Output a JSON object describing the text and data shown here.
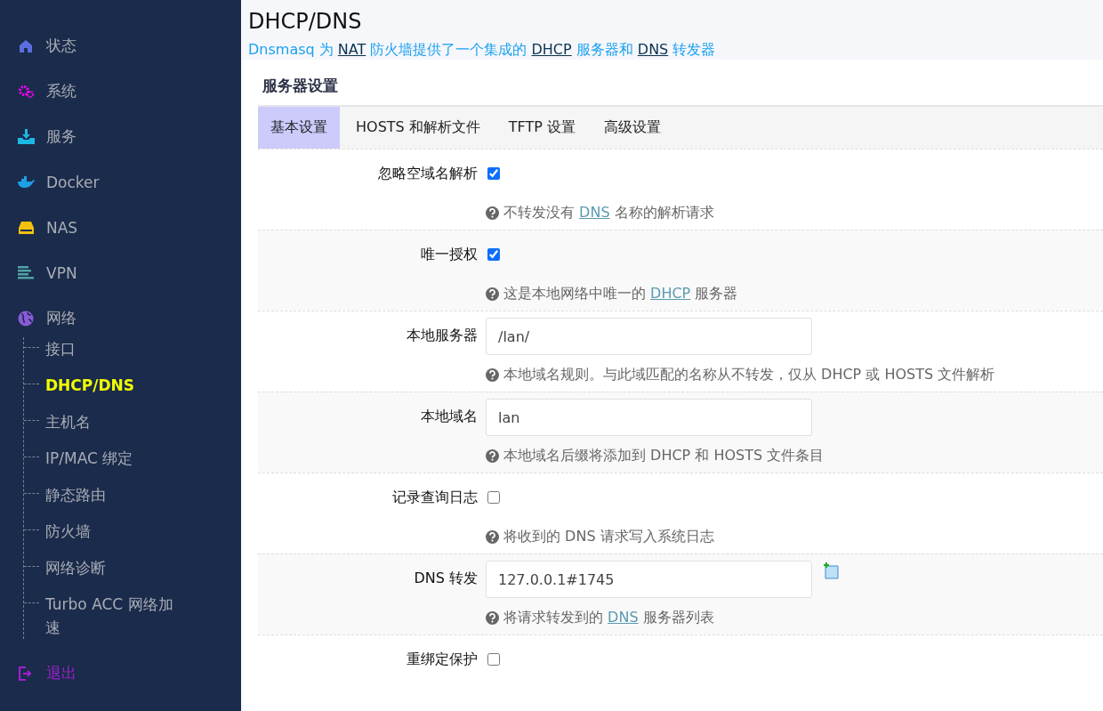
{
  "sidebar": {
    "items": [
      {
        "label": "状态",
        "kind": "home",
        "selected": false
      },
      {
        "label": "系统",
        "kind": "gears",
        "selected": false
      },
      {
        "label": "服务",
        "kind": "download",
        "selected": false
      },
      {
        "label": "Docker",
        "kind": "whale",
        "selected": false
      },
      {
        "label": "NAS",
        "kind": "drive",
        "selected": false
      },
      {
        "label": "VPN",
        "kind": "lines",
        "selected": false
      },
      {
        "label": "网络",
        "kind": "globe",
        "selected": false,
        "children": [
          {
            "label": "接口",
            "selected": false
          },
          {
            "label": "DHCP/DNS",
            "selected": true
          },
          {
            "label": "主机名",
            "selected": false
          },
          {
            "label": "IP/MAC 绑定",
            "selected": false
          },
          {
            "label": "静态路由",
            "selected": false
          },
          {
            "label": "防火墙",
            "selected": false
          },
          {
            "label": "网络诊断",
            "selected": false
          },
          {
            "label": "Turbo ACC 网络加速",
            "selected": false
          }
        ]
      },
      {
        "label": "退出",
        "kind": "logout",
        "selected": false
      }
    ]
  },
  "page": {
    "title": "DHCP/DNS",
    "description": [
      {
        "kind": "text",
        "text": "Dnsmasq 为 "
      },
      {
        "kind": "link",
        "text": "NAT"
      },
      {
        "kind": "text",
        "text": " 防火墙提供了一个集成的 "
      },
      {
        "kind": "link",
        "text": "DHCP"
      },
      {
        "kind": "text",
        "text": " 服务器和 "
      },
      {
        "kind": "link",
        "text": "DNS"
      },
      {
        "kind": "text",
        "text": " 转发器"
      }
    ]
  },
  "section": {
    "title": "服务器设置",
    "tabs": [
      {
        "label": "基本设置",
        "selected": true
      },
      {
        "label": "HOSTS 和解析文件",
        "selected": false
      },
      {
        "label": "TFTP 设置",
        "selected": false
      },
      {
        "label": "高级设置",
        "selected": false
      }
    ],
    "rows": [
      {
        "label": "忽略空域名解析",
        "kind": "checkbox",
        "checked": true,
        "hint": [
          {
            "kind": "text",
            "text": "不转发没有 "
          },
          {
            "kind": "link",
            "text": "DNS"
          },
          {
            "kind": "text",
            "text": " 名称的解析请求"
          }
        ]
      },
      {
        "label": "唯一授权",
        "kind": "checkbox",
        "checked": true,
        "hint": [
          {
            "kind": "text",
            "text": "这是本地网络中唯一的 "
          },
          {
            "kind": "link",
            "text": "DHCP"
          },
          {
            "kind": "text",
            "text": " 服务器"
          }
        ]
      },
      {
        "label": "本地服务器",
        "kind": "input",
        "value": "/lan/",
        "hint": [
          {
            "kind": "text",
            "text": "本地域名规则。与此域匹配的名称从不转发，仅从 DHCP 或 HOSTS 文件解析"
          }
        ]
      },
      {
        "label": "本地域名",
        "kind": "input",
        "value": "lan",
        "hint": [
          {
            "kind": "text",
            "text": "本地域名后缀将添加到 DHCP 和 HOSTS 文件条目"
          }
        ]
      },
      {
        "label": "记录查询日志",
        "kind": "checkbox",
        "checked": false,
        "hint": [
          {
            "kind": "text",
            "text": "将收到的 DNS 请求写入系统日志"
          }
        ]
      },
      {
        "label": "DNS 转发",
        "kind": "dynlist",
        "value": "127.0.0.1#1745",
        "hint": [
          {
            "kind": "text",
            "text": "将请求转发到的 "
          },
          {
            "kind": "link",
            "text": "DNS"
          },
          {
            "kind": "text",
            "text": " 服务器列表"
          }
        ]
      },
      {
        "label": "重绑定保护",
        "kind": "checkbox",
        "checked": false
      }
    ]
  }
}
